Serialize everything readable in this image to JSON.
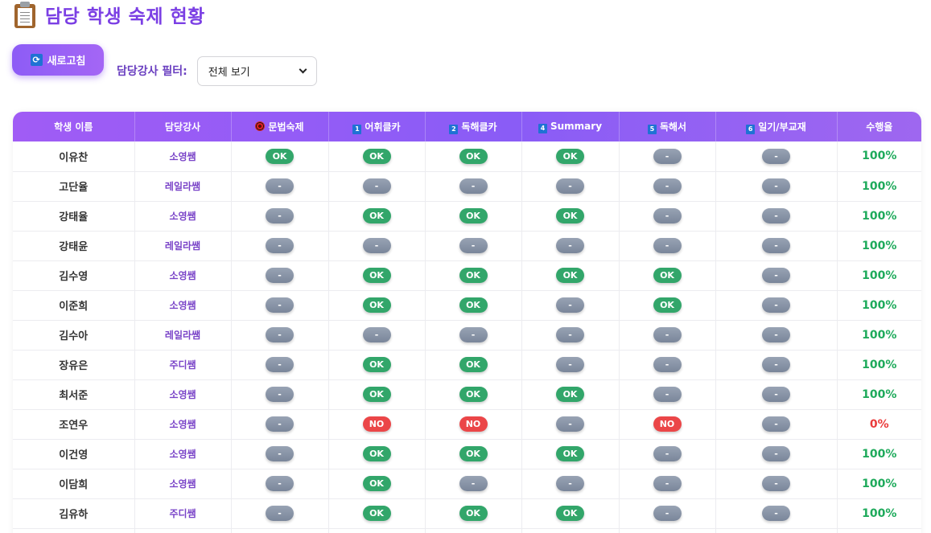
{
  "page": {
    "title": "담당 학생 숙제 현황",
    "title_icon": "clipboard-icon"
  },
  "toolbar": {
    "refresh_label": "새로고침",
    "refresh_icon": "refresh-icon",
    "filter_label": "담당강사 필터:",
    "filter_value": "전체 보기"
  },
  "colors": {
    "accent": "#8a5cf6",
    "ok": "#32a66a",
    "no": "#eb4648",
    "dash": "#8a95a8"
  },
  "table": {
    "headers": {
      "student": "학생 이름",
      "teacher": "담당강사",
      "grammar": "문법숙제",
      "vocab": "어휘클카",
      "reading": "독해클카",
      "summary": "Summary",
      "book": "독해서",
      "diary": "일기/부교재",
      "rate": "수행율"
    },
    "header_icons": {
      "grammar": "target-icon",
      "vocab": "1",
      "reading": "2",
      "summary": "4",
      "book": "5",
      "diary": "6"
    },
    "rows": [
      {
        "student": "이유찬",
        "teacher": "소영쌤",
        "grammar": "OK",
        "vocab": "OK",
        "reading": "OK",
        "summary": "OK",
        "book": "-",
        "diary": "-",
        "rate": "100%"
      },
      {
        "student": "고단율",
        "teacher": "레일라쌤",
        "grammar": "-",
        "vocab": "-",
        "reading": "-",
        "summary": "-",
        "book": "-",
        "diary": "-",
        "rate": "100%"
      },
      {
        "student": "강태율",
        "teacher": "소영쌤",
        "grammar": "-",
        "vocab": "OK",
        "reading": "OK",
        "summary": "OK",
        "book": "-",
        "diary": "-",
        "rate": "100%"
      },
      {
        "student": "강태윤",
        "teacher": "레일라쌤",
        "grammar": "-",
        "vocab": "-",
        "reading": "-",
        "summary": "-",
        "book": "-",
        "diary": "-",
        "rate": "100%"
      },
      {
        "student": "김수영",
        "teacher": "소영쌤",
        "grammar": "-",
        "vocab": "OK",
        "reading": "OK",
        "summary": "OK",
        "book": "OK",
        "diary": "-",
        "rate": "100%"
      },
      {
        "student": "이준희",
        "teacher": "소영쌤",
        "grammar": "-",
        "vocab": "OK",
        "reading": "OK",
        "summary": "-",
        "book": "OK",
        "diary": "-",
        "rate": "100%"
      },
      {
        "student": "김수아",
        "teacher": "레일라쌤",
        "grammar": "-",
        "vocab": "-",
        "reading": "-",
        "summary": "-",
        "book": "-",
        "diary": "-",
        "rate": "100%"
      },
      {
        "student": "장유은",
        "teacher": "주디쌤",
        "grammar": "-",
        "vocab": "OK",
        "reading": "OK",
        "summary": "-",
        "book": "-",
        "diary": "-",
        "rate": "100%"
      },
      {
        "student": "최서준",
        "teacher": "소영쌤",
        "grammar": "-",
        "vocab": "OK",
        "reading": "OK",
        "summary": "OK",
        "book": "-",
        "diary": "-",
        "rate": "100%"
      },
      {
        "student": "조연우",
        "teacher": "소영쌤",
        "grammar": "-",
        "vocab": "NO",
        "reading": "NO",
        "summary": "-",
        "book": "NO",
        "diary": "-",
        "rate": "0%"
      },
      {
        "student": "이건영",
        "teacher": "소영쌤",
        "grammar": "-",
        "vocab": "OK",
        "reading": "OK",
        "summary": "OK",
        "book": "-",
        "diary": "-",
        "rate": "100%"
      },
      {
        "student": "이담희",
        "teacher": "소영쌤",
        "grammar": "-",
        "vocab": "OK",
        "reading": "-",
        "summary": "-",
        "book": "-",
        "diary": "-",
        "rate": "100%"
      },
      {
        "student": "김유하",
        "teacher": "주디쌤",
        "grammar": "-",
        "vocab": "OK",
        "reading": "OK",
        "summary": "OK",
        "book": "-",
        "diary": "-",
        "rate": "100%"
      },
      {
        "student": "",
        "teacher": "",
        "grammar": "",
        "vocab": "",
        "reading": "",
        "summary": "",
        "book": "",
        "diary": "",
        "rate": ""
      }
    ]
  }
}
